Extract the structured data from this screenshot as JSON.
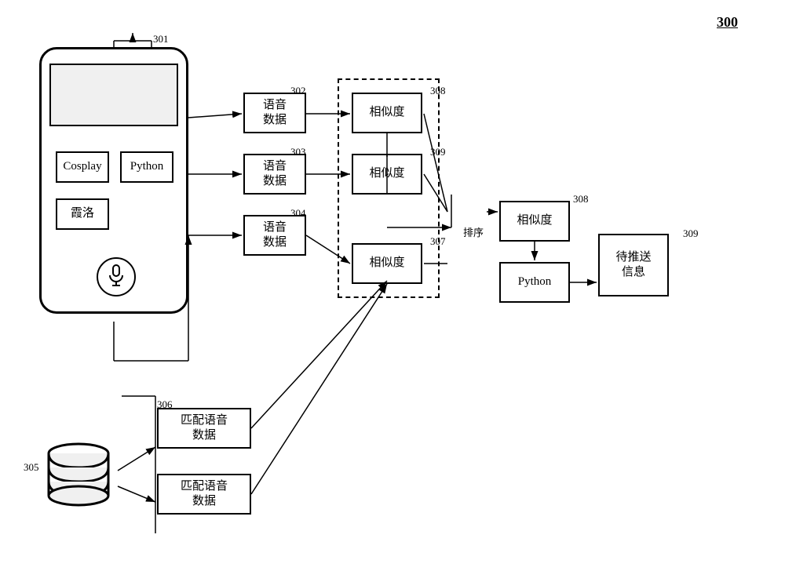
{
  "figure": {
    "number": "300",
    "labels": {
      "301": "301",
      "302": "302",
      "303": "303",
      "304": "304",
      "305": "305",
      "306": "306",
      "307": "307",
      "308": "308",
      "309": "309",
      "paixu": "排序"
    },
    "phone": {
      "item1": "Cosplay",
      "item2": "Python",
      "item3": "霞洛"
    },
    "boxes": {
      "yy_data": "语音\n数据",
      "similarity": "相似度",
      "match_audio": "匹配语音\n数据",
      "python_label": "Python",
      "pending_push": "待推送\n信息"
    }
  }
}
